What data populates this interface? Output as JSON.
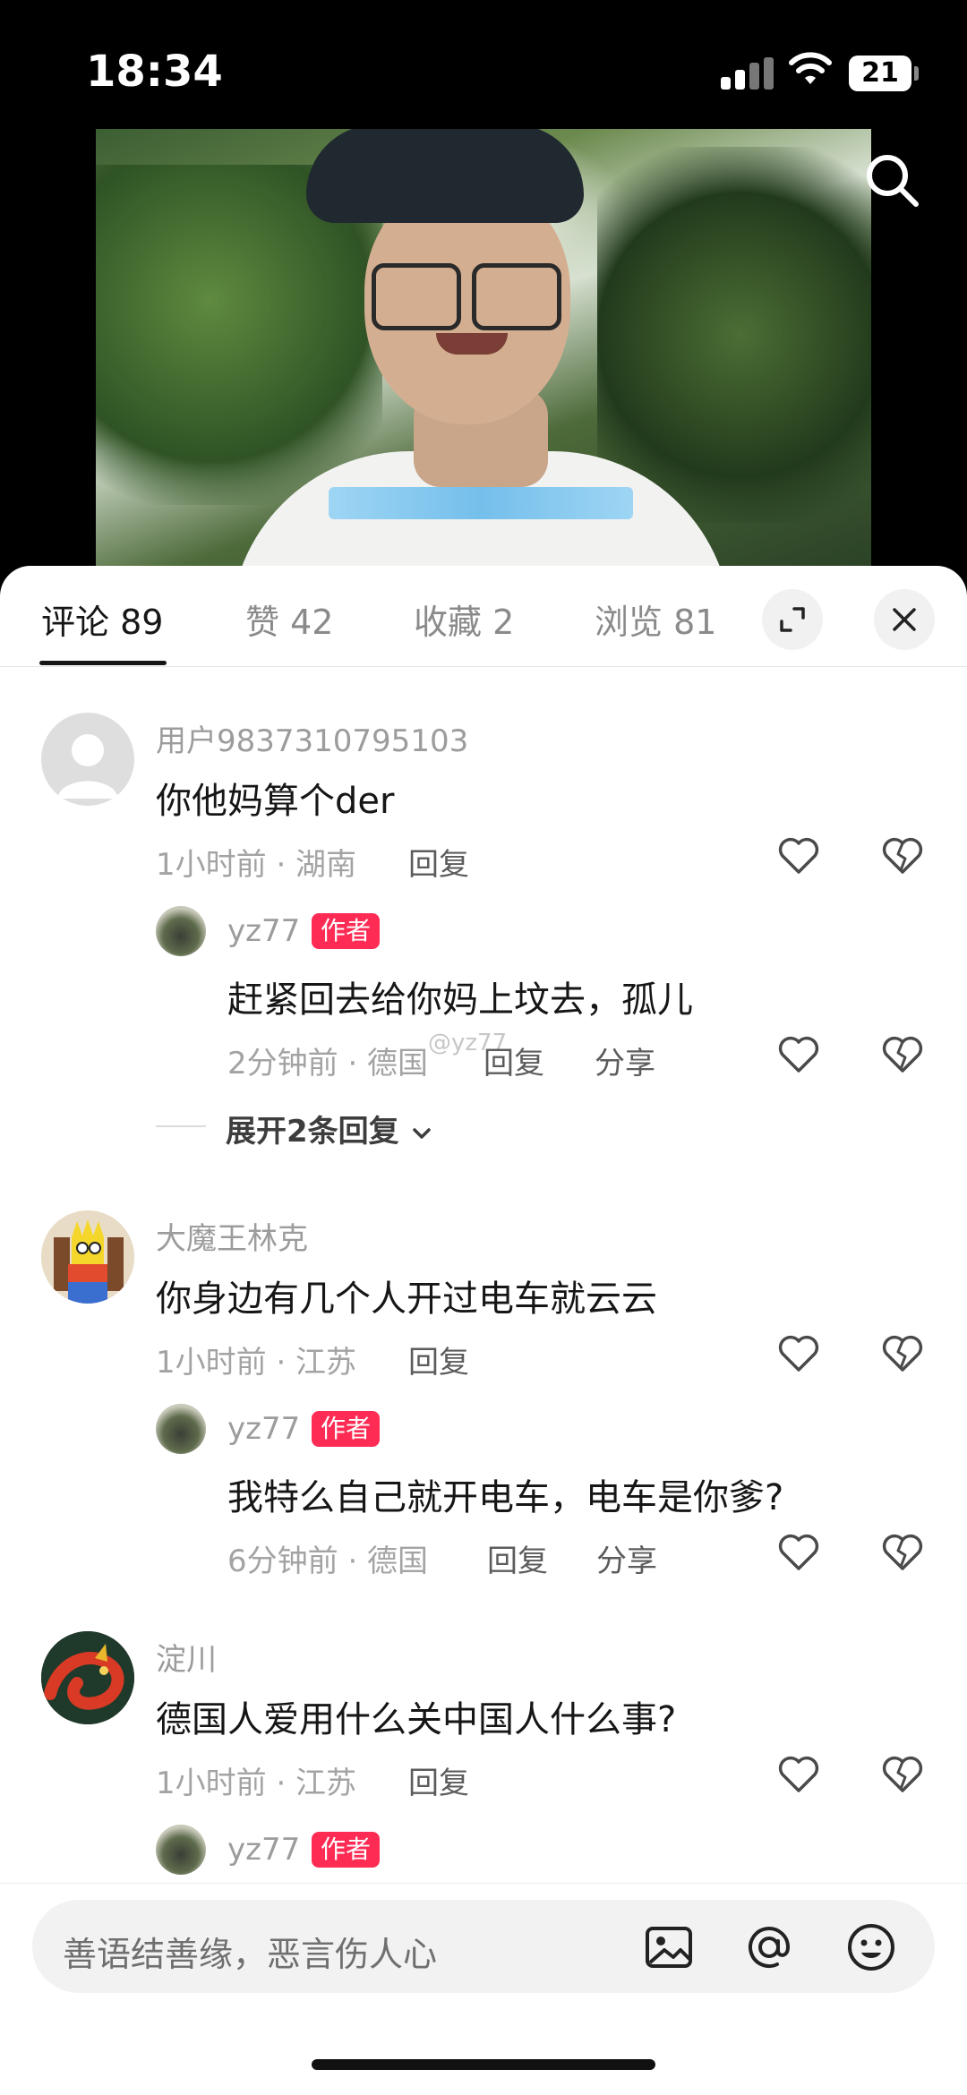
{
  "status_bar": {
    "time": "18:34",
    "battery": "21"
  },
  "video": {
    "subtitle_text": ""
  },
  "tabs": [
    {
      "label": "评论 89",
      "active": true
    },
    {
      "label": "赞 42",
      "active": false
    },
    {
      "label": "收藏 2",
      "active": false
    },
    {
      "label": "浏览 81",
      "active": false
    }
  ],
  "comments": [
    {
      "username": "用户9837310795103",
      "text": "你他妈算个der",
      "meta": "1小时前 · 湖南",
      "reply_label": "回复",
      "avatar_icon": "default-avatar-icon",
      "reply": {
        "username": "yz77",
        "badge": "作者",
        "text": "赶紧回去给你妈上坟去，孤儿",
        "meta": "2分钟前 · 德国",
        "reply_label": "回复",
        "share_label": "分享"
      },
      "expand_label": "展开2条回复"
    },
    {
      "username": "大魔王林克",
      "text": "你身边有几个人开过电车就云云",
      "meta": "1小时前 · 江苏",
      "reply_label": "回复",
      "avatar_icon": "cartoon-avatar",
      "reply": {
        "username": "yz77",
        "badge": "作者",
        "text": "我特么自己就开电车，电车是你爹?",
        "meta": "6分钟前 · 德国",
        "reply_label": "回复",
        "share_label": "分享"
      }
    },
    {
      "username": "淀川",
      "text": "德国人爱用什么关中国人什么事?",
      "meta": "1小时前 · 江苏",
      "reply_label": "回复",
      "avatar_icon": "dragon-avatar",
      "reply": {
        "username": "yz77",
        "badge": "作者"
      }
    }
  ],
  "watermark": "@yz77",
  "input": {
    "placeholder": "善语结善缘，恶言伤人心"
  },
  "colors": {
    "accent": "#fe2c55",
    "text": "#161616",
    "meta": "#a3a3a3"
  }
}
